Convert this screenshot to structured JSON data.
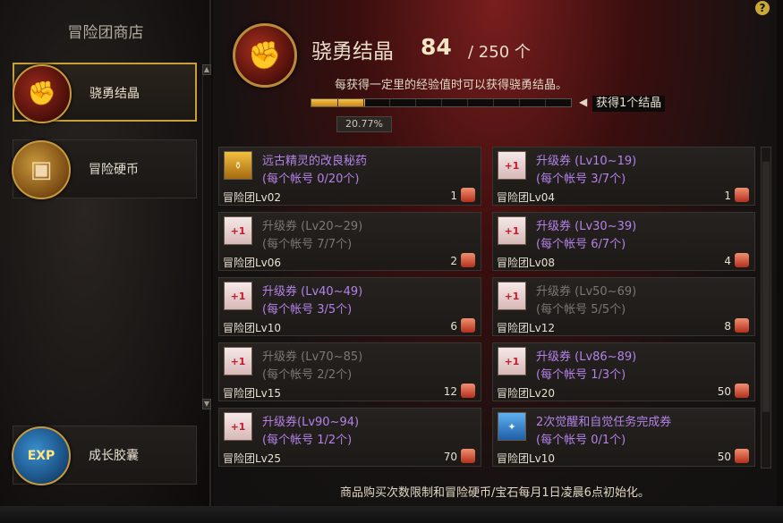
{
  "sidebar": {
    "title": "冒险团商店",
    "items": [
      {
        "label": "骁勇结晶",
        "icon": "fist-crystal-icon",
        "active": true
      },
      {
        "label": "冒险硬币",
        "icon": "treasure-chest-icon",
        "active": false
      },
      {
        "label": "成长胶囊",
        "icon": "exp-capsule-icon",
        "active": false
      }
    ]
  },
  "header": {
    "title": "骁勇结晶",
    "count": "84",
    "total": "/ 250 个",
    "description": "每获得一定里的经验值时可以获得骁勇结晶。",
    "progress_percent": 20.77,
    "progress_label": "20.77%",
    "reward_arrow": "◀",
    "reward_label": "获得1个结晶",
    "help": "?"
  },
  "items": [
    {
      "name": "远古精灵的改良秘药",
      "limit": "(每个帐号 0/20个)",
      "req": "冒险团Lv02",
      "price": "1",
      "icon": "potion-icon",
      "dim": false
    },
    {
      "name": "升级券 (Lv10~19)",
      "limit": "(每个帐号 3/7个)",
      "req": "冒险团Lv04",
      "price": "1",
      "icon": "level-ticket-icon",
      "dim": false
    },
    {
      "name": "升级券 (Lv20~29)",
      "limit": "(每个帐号 7/7个)",
      "req": "冒险团Lv06",
      "price": "2",
      "icon": "level-ticket-icon",
      "dim": true
    },
    {
      "name": "升级券 (Lv30~39)",
      "limit": "(每个帐号 6/7个)",
      "req": "冒险团Lv08",
      "price": "4",
      "icon": "level-ticket-icon",
      "dim": false
    },
    {
      "name": "升级券 (Lv40~49)",
      "limit": "(每个帐号 3/5个)",
      "req": "冒险团Lv10",
      "price": "6",
      "icon": "level-ticket-icon",
      "dim": false
    },
    {
      "name": "升级券 (Lv50~69)",
      "limit": "(每个帐号 5/5个)",
      "req": "冒险团Lv12",
      "price": "8",
      "icon": "level-ticket-icon",
      "dim": true
    },
    {
      "name": "升级券 (Lv70~85)",
      "limit": "(每个帐号 2/2个)",
      "req": "冒险团Lv15",
      "price": "12",
      "icon": "level-ticket-icon",
      "dim": true
    },
    {
      "name": "升级券 (Lv86~89)",
      "limit": "(每个帐号 1/3个)",
      "req": "冒险团Lv20",
      "price": "50",
      "icon": "level-ticket-icon",
      "dim": false
    },
    {
      "name": "升级券(Lv90~94)",
      "limit": "(每个帐号 1/2个)",
      "req": "冒险团Lv25",
      "price": "70",
      "icon": "level-ticket-icon",
      "dim": false
    },
    {
      "name": "2次觉醒和自觉任务完成券",
      "limit": "(每个帐号 0/1个)",
      "req": "冒险团Lv10",
      "price": "50",
      "icon": "awakening-ticket-icon",
      "dim": false
    }
  ],
  "ticket_glyph": "+1",
  "footer": "商品购买次数限制和冒险硬币/宝石每月1日凌晨6点初始化。",
  "colors": {
    "accent": "#c8a03a",
    "item_text": "#b482e8",
    "dim_text": "#7e7670",
    "progress": "#f0b030"
  }
}
